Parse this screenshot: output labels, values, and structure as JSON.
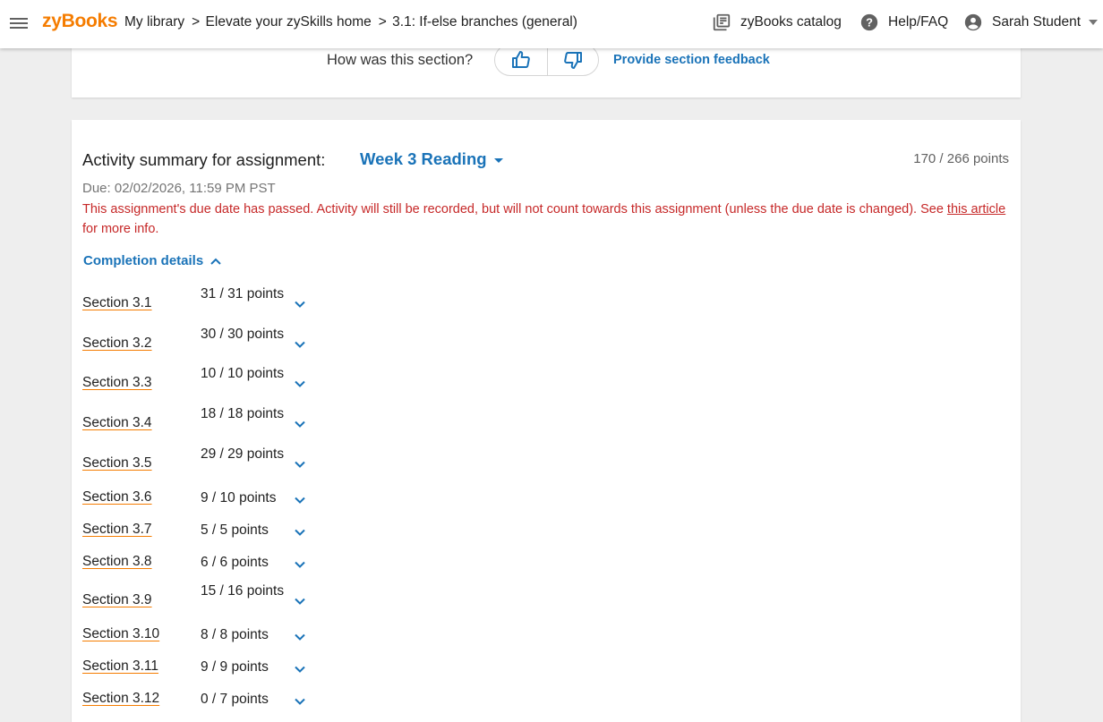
{
  "header": {
    "logo": "zyBooks",
    "breadcrumbs": [
      "My library",
      "Elevate your zySkills home",
      "3.1: If-else branches (general)"
    ],
    "catalog_label": "zyBooks catalog",
    "help_label": "Help/FAQ",
    "user_name": "Sarah Student"
  },
  "feedback": {
    "question": "How was this section?",
    "link_label": "Provide section feedback"
  },
  "activity": {
    "title": "Activity summary for assignment:",
    "assignment": "Week 3 Reading",
    "points_total": "170 / 266 points",
    "due": "Due: 02/02/2026, 11:59 PM PST",
    "warning_text": "This assignment's due date has passed. Activity will still be recorded, but will not count towards this assignment (unless the due date is changed). See ",
    "warning_link": "this article",
    "warning_tail": " for more info.",
    "completion_label": "Completion details",
    "sections": [
      {
        "label": "Section 3.1",
        "points": "31 / 31 points"
      },
      {
        "label": "Section 3.2",
        "points": "30 / 30 points"
      },
      {
        "label": "Section 3.3",
        "points": "10 / 10 points"
      },
      {
        "label": "Section 3.4",
        "points": "18 / 18 points"
      },
      {
        "label": "Section 3.5",
        "points": "29 / 29 points"
      },
      {
        "label": "Section 3.6",
        "points": "9 / 10 points"
      },
      {
        "label": "Section 3.7",
        "points": "5 / 5 points"
      },
      {
        "label": "Section 3.8",
        "points": "6 / 6 points"
      },
      {
        "label": "Section 3.9",
        "points": "15 / 16 points"
      },
      {
        "label": "Section 3.10",
        "points": "8 / 8 points"
      },
      {
        "label": "Section 3.11",
        "points": "9 / 9 points"
      },
      {
        "label": "Section 3.12",
        "points": "0 / 7 points"
      }
    ]
  },
  "colors": {
    "brand": "#f57c00",
    "link": "#1a73b8",
    "warning": "#c62828"
  }
}
